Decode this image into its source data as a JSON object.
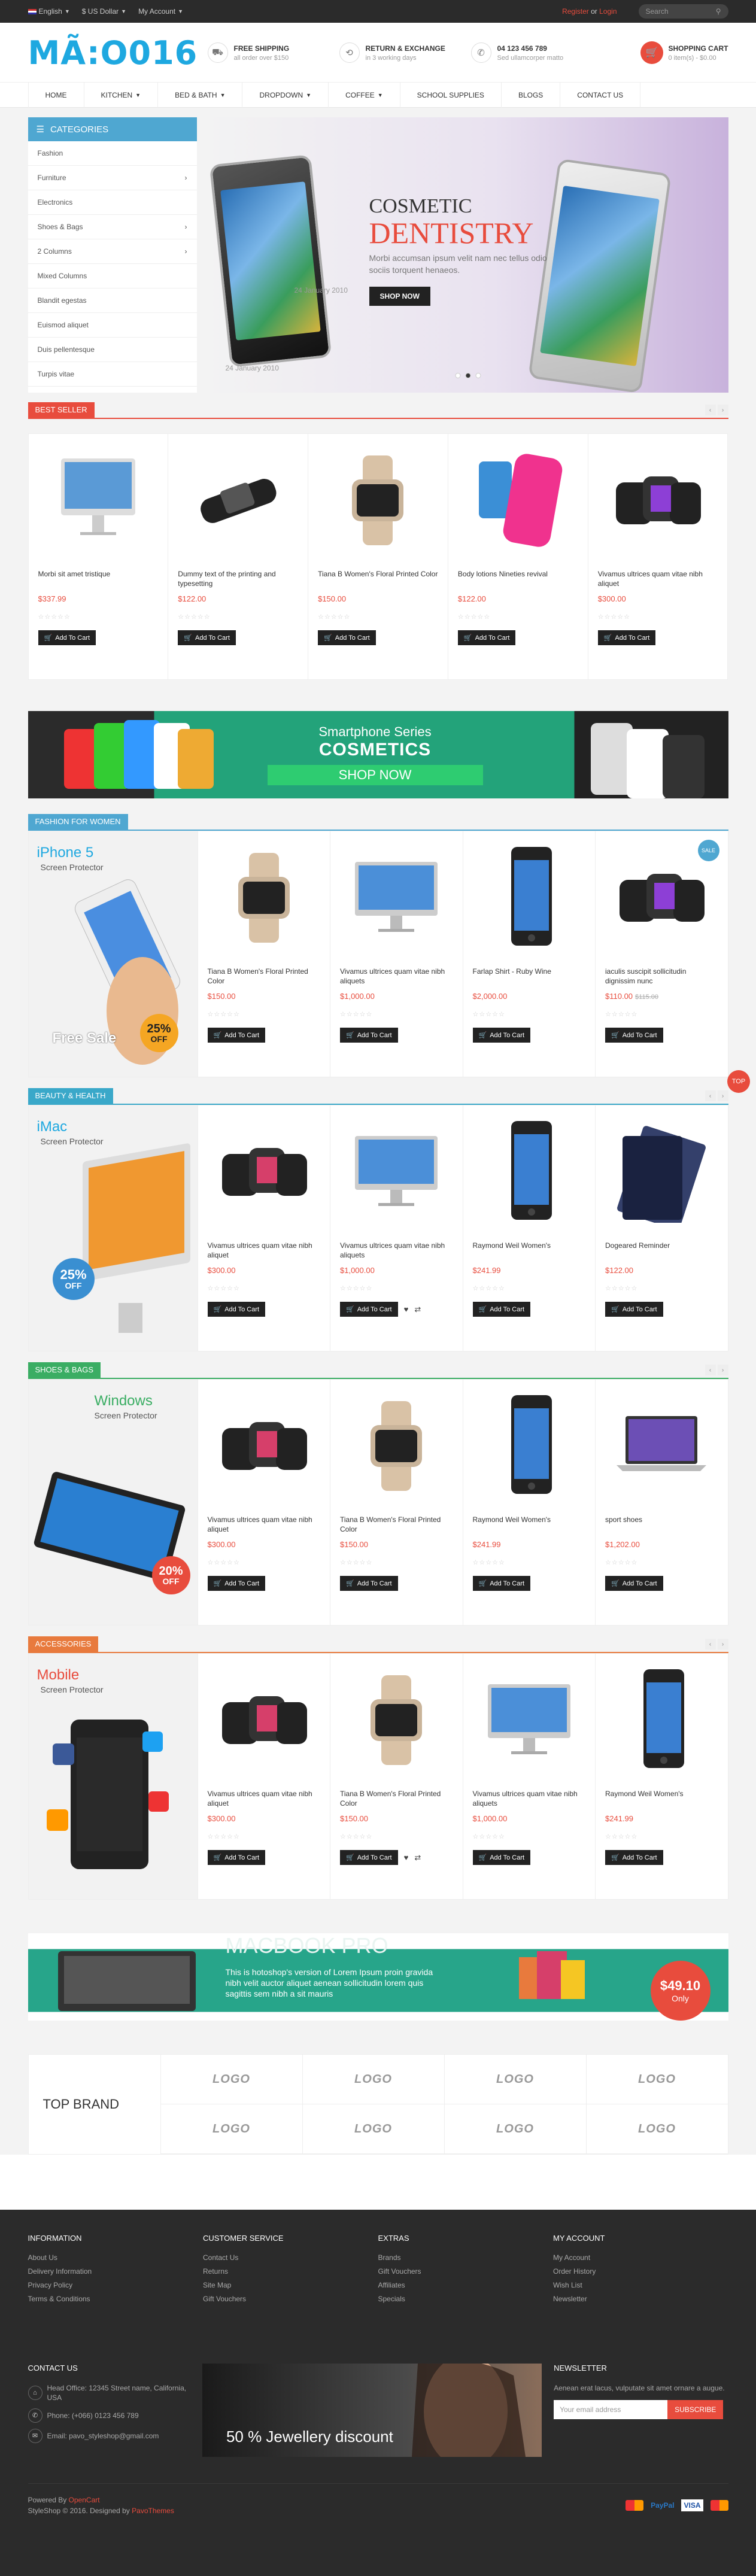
{
  "topbar": {
    "language": "English",
    "currency": "$ US Dollar",
    "account": "My Account",
    "register": "Register",
    "or": "or",
    "login": "Login",
    "search_placeholder": "Search"
  },
  "header": {
    "logo": "MÃ:O016",
    "features": [
      {
        "title": "Free Shipping",
        "sub": "all order over $150",
        "icon": "truck-icon"
      },
      {
        "title": "Return & Exchange",
        "sub": "in 3 working days",
        "icon": "return-icon"
      },
      {
        "title": "04 123 456 789",
        "sub": "Sed ullamcorper matto",
        "icon": "phone-icon"
      }
    ],
    "cart_title": "Shopping Cart",
    "cart_sub": "0 item(s) - $0.00"
  },
  "nav": [
    "Home",
    "Kitchen",
    "Bed & Bath",
    "Dropdown",
    "Coffee",
    "School Supplies",
    "Blogs",
    "Contact Us"
  ],
  "categories": {
    "title": "Categories",
    "items": [
      "Fashion",
      "Furniture",
      "Electronics",
      "Shoes & Bags",
      "2 Columns",
      "Mixed Columns",
      "Blandit egestas",
      "Euismod aliquet",
      "Duis pellentesque",
      "Turpis vitae"
    ]
  },
  "slider": {
    "line1": "COSMETIC",
    "line2": "DENTISTRY",
    "desc": "Morbi accumsan ipsum velit nam nec tellus odio sociis torquent henaeos.",
    "button": "SHOP NOW",
    "date1": "24 January 2010",
    "date2": "24 January 2010"
  },
  "best_seller": {
    "title": "Best Seller",
    "products": [
      {
        "name": "Morbi sit amet tristique",
        "price": "$337.99"
      },
      {
        "name": "Dummy text of the printing and typesetting",
        "price": "$122.00"
      },
      {
        "name": "Tiana B Women's Floral Printed Color",
        "price": "$150.00"
      },
      {
        "name": "Body lotions Nineties revival",
        "price": "$122.00"
      },
      {
        "name": "Vivamus ultrices quam vitae nibh aliquet",
        "price": "$300.00"
      }
    ]
  },
  "add_to_cart": "Add To Cart",
  "banner_smartphone": {
    "line1": "Smartphone Series",
    "line2": "COSMETICS",
    "button": "SHOP NOW"
  },
  "fashion": {
    "title": "Fashion For Women",
    "promo_title": "iPhone 5",
    "promo_sub": "Screen Protector",
    "promo_sale": "Free Sale",
    "badge": "25%",
    "badge_off": "OFF",
    "sale_tag": "SALE",
    "products": [
      {
        "name": "Tiana B Women's Floral Printed Color",
        "price": "$150.00",
        "old": ""
      },
      {
        "name": "Vivamus ultrices quam vitae nibh aliquets",
        "price": "$1,000.00",
        "old": ""
      },
      {
        "name": "Farlap Shirt - Ruby Wine",
        "price": "$2,000.00",
        "old": ""
      },
      {
        "name": "iaculis suscipit sollicitudin dignissim nunc",
        "price": "$110.00",
        "old": "$115.00"
      }
    ]
  },
  "beauty": {
    "title": "Beauty & Health",
    "promo_title": "iMac",
    "promo_sub": "Screen Protector",
    "badge": "25%",
    "badge_off": "OFF",
    "products": [
      {
        "name": "Vivamus ultrices quam vitae nibh aliquet",
        "price": "$300.00"
      },
      {
        "name": "Vivamus ultrices quam vitae nibh aliquets",
        "price": "$1,000.00"
      },
      {
        "name": "Raymond Weil Women's",
        "price": "$241.99"
      },
      {
        "name": "Dogeared Reminder",
        "price": "$122.00"
      }
    ]
  },
  "shoes": {
    "title": "Shoes & Bags",
    "promo_title": "Windows",
    "promo_sub": "Screen Protector",
    "badge": "20%",
    "badge_off": "OFF",
    "products": [
      {
        "name": "Vivamus ultrices quam vitae nibh aliquet",
        "price": "$300.00"
      },
      {
        "name": "Tiana B Women's Floral Printed Color",
        "price": "$150.00"
      },
      {
        "name": "Raymond Weil Women's",
        "price": "$241.99"
      },
      {
        "name": "sport shoes",
        "price": "$1,202.00"
      }
    ]
  },
  "accessories": {
    "title": "Accessories",
    "promo_title": "Mobile",
    "promo_sub": "Screen Protector",
    "products": [
      {
        "name": "Vivamus ultrices quam vitae nibh aliquet",
        "price": "$300.00"
      },
      {
        "name": "Tiana B Women's Floral Printed Color",
        "price": "$150.00"
      },
      {
        "name": "Vivamus ultrices quam vitae nibh aliquets",
        "price": "$1,000.00"
      },
      {
        "name": "Raymond Weil Women's",
        "price": "$241.99"
      }
    ]
  },
  "macbook": {
    "title": "MACBOOK PRO",
    "desc": "This is hotoshop's version of Lorem Ipsum proin gravida nibh velit auctor aliquet aenean sollicitudin lorem quis sagittis sem nibh a sit mauris",
    "price": "$49.10",
    "price_sub": "Only"
  },
  "brands": {
    "title": "TOP BRAND",
    "logo_text": "LOGO"
  },
  "footer": {
    "cols": [
      {
        "title": "Information",
        "links": [
          "About Us",
          "Delivery Information",
          "Privacy Policy",
          "Terms & Conditions"
        ]
      },
      {
        "title": "Customer Service",
        "links": [
          "Contact Us",
          "Returns",
          "Site Map",
          "Gift Vouchers"
        ]
      },
      {
        "title": "Extras",
        "links": [
          "Brands",
          "Gift Vouchers",
          "Affiliates",
          "Specials"
        ]
      },
      {
        "title": "My Account",
        "links": [
          "My Account",
          "Order History",
          "Wish List",
          "Newsletter"
        ]
      }
    ],
    "contact_title": "Contact Us",
    "address": "Head Office: 12345 Street name, California, USA",
    "phone": "Phone: (+066) 0123 456 789",
    "email": "Email: pavo_styleshop@gmail.com",
    "jewellery": "50 % Jewellery discount",
    "newsletter_title": "Newsletter",
    "newsletter_text": "Aenean erat lacus, vulputate sit amet ornare a augue.",
    "newsletter_placeholder": "Your email address",
    "subscribe": "Subscribe",
    "powered": "Powered By",
    "opencart": "OpenCart",
    "copyright": "StyleShop © 2016. Designed by",
    "pavothemes": "PavoThemes",
    "pay_paypal": "PayPal",
    "pay_visa": "VISA"
  },
  "top_button": "TOP",
  "colors": {
    "accent": "#e84c3d",
    "blue": "#4fa7d1",
    "teal": "#3aa8c9",
    "green": "#3aad63"
  }
}
